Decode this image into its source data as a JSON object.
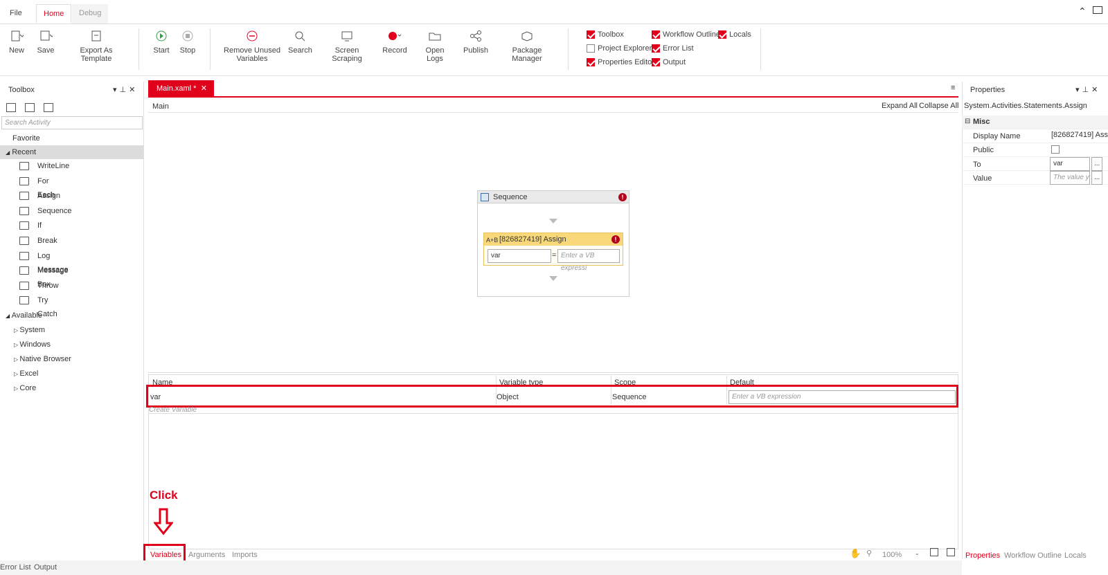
{
  "ribbon_tabs": [
    "File",
    "Home",
    "Debug"
  ],
  "ribbon_buttons": {
    "new": "New",
    "save": "Save",
    "export_template": "Export As Template",
    "start": "Start",
    "stop": "Stop",
    "remove_unused_1": "Remove Unused",
    "remove_unused_2": "Variables",
    "search": "Search",
    "screen_scraping": "Screen Scraping",
    "record": "Record",
    "open_logs": "Open Logs",
    "publish": "Publish",
    "package_manager": "Package Manager"
  },
  "panel_toggles": {
    "toolbox": {
      "label": "Toolbox",
      "checked": true
    },
    "workflow_outline": {
      "label": "Workflow Outline",
      "checked": true
    },
    "locals": {
      "label": "Locals",
      "checked": true
    },
    "project_explorer": {
      "label": "Project Explorer",
      "checked": false
    },
    "error_list": {
      "label": "Error List",
      "checked": true
    },
    "properties_editor": {
      "label": "Properties Editor",
      "checked": true
    },
    "output": {
      "label": "Output",
      "checked": true
    }
  },
  "toolbox": {
    "title": "Toolbox",
    "search_placeholder": "Search Activity",
    "favorite": "Favorite",
    "recent": "Recent",
    "recent_items": [
      "WriteLine",
      "For Each",
      "Assign",
      "Sequence",
      "If",
      "Break",
      "Log Message",
      "Message Box",
      "Throw",
      "Try Catch"
    ],
    "available": "Available",
    "available_items": [
      "System",
      "Windows",
      "Native Browser",
      "Excel",
      "Core"
    ]
  },
  "document": {
    "tab": "Main.xaml *",
    "breadcrumb": "Main",
    "expand_all": "Expand All",
    "collapse_all": "Collapse All"
  },
  "sequence": {
    "title": "Sequence",
    "assign_title": "[826827419] Assign",
    "assign_to": "var",
    "assign_value_placeholder": "Enter a VB expressi"
  },
  "variables": {
    "headers": [
      "Name",
      "Variable type",
      "Scope",
      "Default"
    ],
    "row": {
      "name": "var",
      "type": "Object",
      "scope": "Sequence",
      "default_placeholder": "Enter a VB expression"
    },
    "create": "Create Variable"
  },
  "annotation": "Click",
  "bottom_tabs": [
    "Variables",
    "Arguments",
    "Imports"
  ],
  "zoom": "100%",
  "status_tabs": [
    "Error List",
    "Output"
  ],
  "properties": {
    "title": "Properties",
    "type": "System.Activities.Statements.Assign",
    "category": "Misc",
    "display_name_label": "Display Name",
    "display_name_value": "[826827419] Assi",
    "public_label": "Public",
    "to_label": "To",
    "to_value": "var",
    "value_label": "Value",
    "value_placeholder": "The value y",
    "tabs": [
      "Properties",
      "Workflow Outline",
      "Locals"
    ]
  },
  "colors": {
    "accent": "#e0001b",
    "assign_header": "#f9d87a"
  }
}
